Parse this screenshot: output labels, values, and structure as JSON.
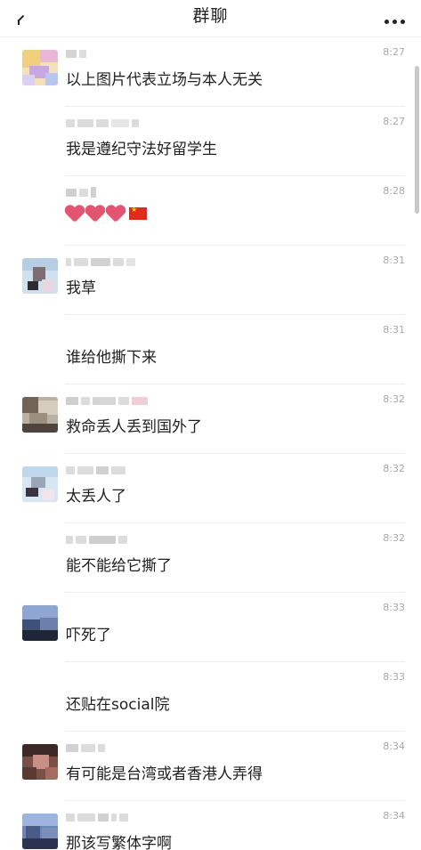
{
  "header": {
    "title": "群聊",
    "back_icon": "back-arrow-icon",
    "more_icon": "more-dots-icon"
  },
  "messages": [
    {
      "time": "8:27",
      "text": "以上图片代表立场与本人无关",
      "has_avatar": true
    },
    {
      "time": "8:27",
      "text": "我是遵纪守法好留学生",
      "has_avatar": false
    },
    {
      "time": "8:28",
      "text": "",
      "emojis": [
        "heart",
        "heart",
        "heart",
        "china-flag"
      ],
      "has_avatar": false
    },
    {
      "time": "8:31",
      "text": "我草",
      "has_avatar": true
    },
    {
      "time": "8:31",
      "text": "谁给他撕下来",
      "has_avatar": false
    },
    {
      "time": "8:32",
      "text": "救命丢人丢到国外了",
      "has_avatar": true
    },
    {
      "time": "8:32",
      "text": "太丢人了",
      "has_avatar": true
    },
    {
      "time": "8:32",
      "text": "能不能给它撕了",
      "has_avatar": false
    },
    {
      "time": "8:33",
      "text": "吓死了",
      "has_avatar": true
    },
    {
      "time": "8:33",
      "text": "还贴在social院",
      "has_avatar": false
    },
    {
      "time": "8:34",
      "text": "有可能是台湾或者香港人弄得",
      "has_avatar": true
    },
    {
      "time": "8:34",
      "text": "那该写繁体字啊",
      "has_avatar": true
    }
  ]
}
